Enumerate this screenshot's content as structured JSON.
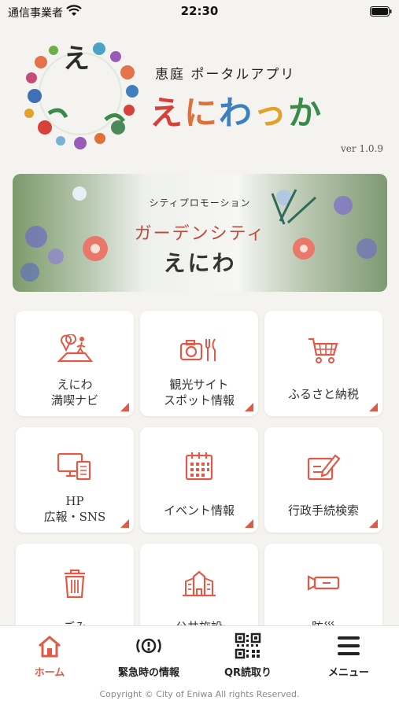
{
  "status_bar": {
    "carrier": "通信事業者",
    "time": "22:30"
  },
  "header": {
    "subtitle": "恵庭 ポータルアプリ",
    "app_name": [
      "え",
      "に",
      "わ",
      "っ",
      "か"
    ],
    "app_name_colors": [
      "#d8403a",
      "#e0703a",
      "#3d7fbf",
      "#e0a22a",
      "#3a8a4a"
    ],
    "version": "ver 1.0.9"
  },
  "banner": {
    "subtitle": "シティプロモーション",
    "title": "ガーデンシティ",
    "title2": "えにわ"
  },
  "tiles": [
    {
      "label_lines": [
        "えにわ",
        "満喫ナビ"
      ],
      "icon": "map-pin-walker-icon"
    },
    {
      "label_lines": [
        "観光サイト",
        "スポット情報"
      ],
      "icon": "camera-cutlery-icon"
    },
    {
      "label_lines": [
        "ふるさと納税"
      ],
      "icon": "shopping-cart-icon"
    },
    {
      "label_lines": [
        "HP",
        "広報・SNS"
      ],
      "icon": "monitor-document-icon"
    },
    {
      "label_lines": [
        "イベント情報"
      ],
      "icon": "calendar-icon"
    },
    {
      "label_lines": [
        "行政手続検索"
      ],
      "icon": "form-pencil-icon"
    },
    {
      "label_lines": [
        "ごみ"
      ],
      "icon": "trash-can-icon"
    },
    {
      "label_lines": [
        "公共施設"
      ],
      "icon": "public-building-icon"
    },
    {
      "label_lines": [
        "防災"
      ],
      "icon": "flashlight-icon"
    }
  ],
  "bottom_nav": {
    "items": [
      {
        "label": "ホーム",
        "icon": "home-icon"
      },
      {
        "label": "緊急時の情報",
        "icon": "emergency-alert-icon"
      },
      {
        "label": "QR読取り",
        "icon": "qr-code-icon"
      },
      {
        "label": "メニュー",
        "icon": "hamburger-menu-icon"
      }
    ],
    "active_index": 0,
    "copyright": "Copyright © City of Eniwa All rights Reserved."
  },
  "colors": {
    "accent": "#e05a47",
    "background": "#f5f3ef"
  }
}
